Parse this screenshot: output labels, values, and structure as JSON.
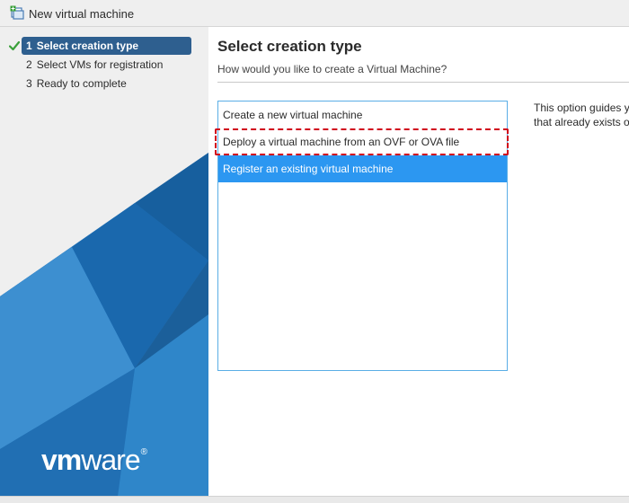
{
  "window": {
    "title": "New virtual machine",
    "title_icon": "new-vm-icon"
  },
  "sidebar": {
    "steps": [
      {
        "number": "1",
        "label": "Select creation type",
        "active": true,
        "completed": true
      },
      {
        "number": "2",
        "label": "Select VMs for registration",
        "active": false,
        "completed": false
      },
      {
        "number": "3",
        "label": "Ready to complete",
        "active": false,
        "completed": false
      }
    ],
    "logo": {
      "vm": "vm",
      "ware": "ware",
      "mark": "®"
    },
    "colors": {
      "active_step": "#2e5f8f",
      "check": "#3aa03a"
    }
  },
  "main": {
    "title": "Select creation type",
    "subtitle": "How would you like to create a Virtual Machine?",
    "options": [
      {
        "label": "Create a new virtual machine",
        "selected": false
      },
      {
        "label": "Deploy a virtual machine from an OVF or OVA file",
        "selected": false,
        "highlighted": true
      },
      {
        "label": "Register an existing virtual machine",
        "selected": true
      }
    ],
    "description_lines": [
      "This option guides y",
      "that already exists o"
    ],
    "colors": {
      "selected": "#2c97f1",
      "list_border": "#5aaee6",
      "highlight": "#d0021b"
    }
  }
}
